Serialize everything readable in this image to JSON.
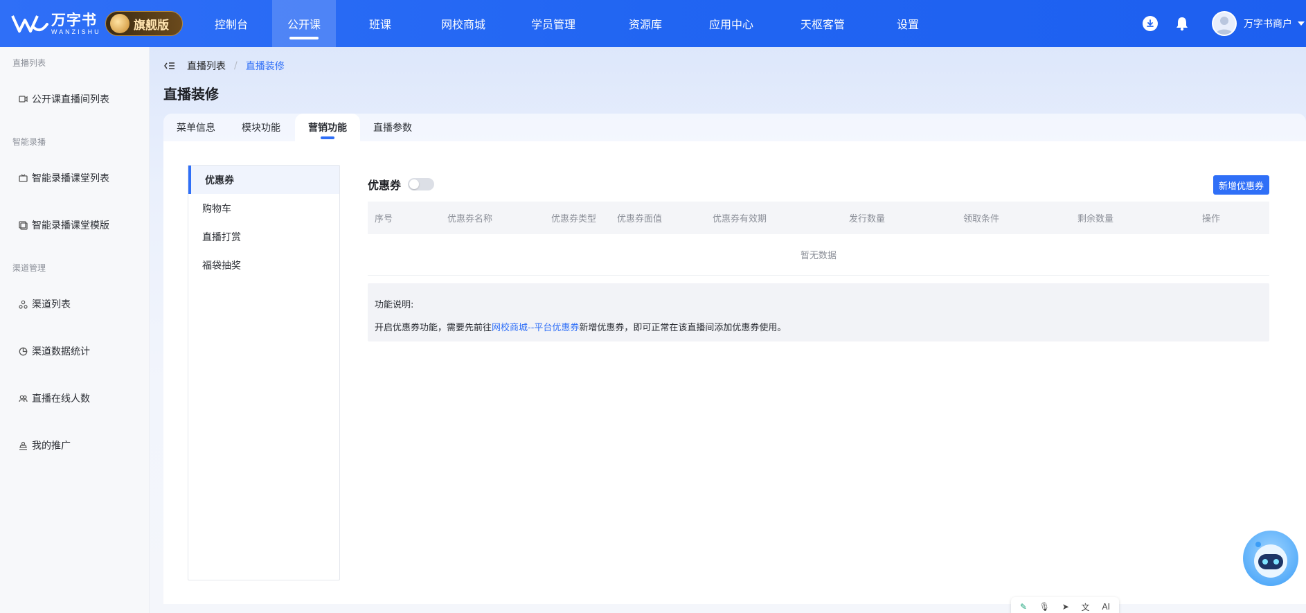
{
  "brand": {
    "name_cn": "万字书",
    "name_en": "WANZISHU",
    "edition": "旗舰版",
    "brand_color": "#2165F2"
  },
  "topnav": {
    "items": [
      {
        "label": "控制台"
      },
      {
        "label": "公开课",
        "active": true
      },
      {
        "label": "班课"
      },
      {
        "label": "网校商城"
      },
      {
        "label": "学员管理"
      },
      {
        "label": "资源库"
      },
      {
        "label": "应用中心"
      },
      {
        "label": "天枢客管"
      },
      {
        "label": "设置"
      }
    ],
    "user_name": "万字书商户",
    "icons": [
      "download-icon",
      "bell-icon",
      "avatar"
    ]
  },
  "sidebar": {
    "groups": [
      {
        "title": "直播列表",
        "items": [
          {
            "label": "公开课直播间列表",
            "icon": "video-icon"
          }
        ]
      },
      {
        "title": "智能录播",
        "items": [
          {
            "label": "智能录播课堂列表",
            "icon": "tv-icon"
          },
          {
            "label": "智能录播课堂模版",
            "icon": "template-icon"
          }
        ]
      },
      {
        "title": "渠道管理",
        "items": [
          {
            "label": "渠道列表",
            "icon": "channel-icon"
          },
          {
            "label": "渠道数据统计",
            "icon": "pie-chart-icon"
          },
          {
            "label": "直播在线人数",
            "icon": "users-icon"
          },
          {
            "label": "我的推广",
            "icon": "promo-icon"
          }
        ]
      }
    ]
  },
  "breadcrumb": {
    "parent": "直播列表",
    "separator": "/",
    "current": "直播装修"
  },
  "page_title": "直播装修",
  "tabs": [
    {
      "label": "菜单信息"
    },
    {
      "label": "模块功能"
    },
    {
      "label": "营销功能",
      "active": true
    },
    {
      "label": "直播参数"
    }
  ],
  "subnav": [
    {
      "label": "优惠券",
      "active": true
    },
    {
      "label": "购物车"
    },
    {
      "label": "直播打赏"
    },
    {
      "label": "福袋抽奖"
    }
  ],
  "coupon": {
    "title": "优惠券",
    "enabled": false,
    "add_button": "新增优惠券",
    "columns": [
      "序号",
      "优惠券名称",
      "优惠券类型",
      "优惠券面值",
      "优惠券有效期",
      "发行数量",
      "领取条件",
      "剩余数量",
      "操作"
    ],
    "rows": [],
    "empty_text": "暂无数据",
    "note_title": "功能说明:",
    "note_prefix": "开启优惠券功能，需要先前往",
    "note_link": "网校商城--平台优惠券",
    "note_suffix": "新增优惠券，即可正常在该直播间添加优惠券使用。"
  },
  "mini_toolbar": {
    "ai_label": "AI"
  }
}
